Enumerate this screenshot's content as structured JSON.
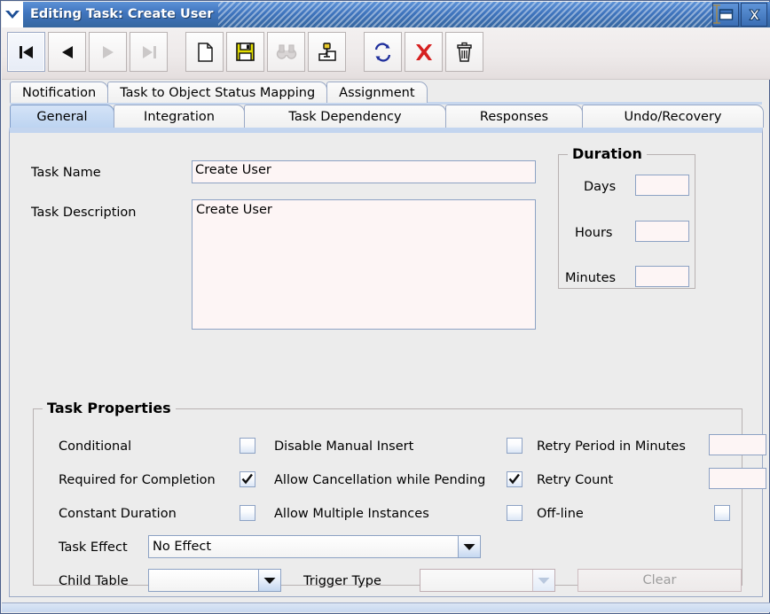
{
  "window": {
    "title": "Editing Task: Create User",
    "menu_icon": "chevron-down-icon",
    "maximize_icon": "maximize-icon",
    "close_icon": "close-icon"
  },
  "toolbar": {
    "buttons": [
      {
        "name": "first-record-button",
        "icon": "first-record-icon",
        "enabled": true,
        "selected": true
      },
      {
        "name": "previous-record-button",
        "icon": "previous-record-icon",
        "enabled": true,
        "selected": false
      },
      {
        "name": "next-record-button",
        "icon": "next-record-icon",
        "enabled": false,
        "selected": false
      },
      {
        "name": "last-record-button",
        "icon": "last-record-icon",
        "enabled": false,
        "selected": false
      },
      {
        "name": "new-button",
        "icon": "new-document-icon",
        "enabled": true,
        "selected": false
      },
      {
        "name": "save-button",
        "icon": "floppy-disk-save-icon",
        "enabled": true,
        "selected": false
      },
      {
        "name": "find-button",
        "icon": "binoculars-find-icon",
        "enabled": false,
        "selected": false
      },
      {
        "name": "query-button",
        "icon": "pushpin-folder-icon",
        "enabled": true,
        "selected": false
      },
      {
        "name": "refresh-button",
        "icon": "refresh-arrows-icon",
        "enabled": true,
        "selected": false
      },
      {
        "name": "delete-button",
        "icon": "red-x-delete-icon",
        "enabled": true,
        "selected": false
      },
      {
        "name": "trash-button",
        "icon": "trash-bin-icon",
        "enabled": true,
        "selected": false
      }
    ]
  },
  "tabs": {
    "row1": [
      {
        "label": "Notification",
        "active": false
      },
      {
        "label": "Task to Object Status Mapping",
        "active": false
      },
      {
        "label": "Assignment",
        "active": false
      }
    ],
    "row2": [
      {
        "label": "General",
        "active": true
      },
      {
        "label": "Integration",
        "active": false
      },
      {
        "label": "Task Dependency",
        "active": false
      },
      {
        "label": "Responses",
        "active": false
      },
      {
        "label": "Undo/Recovery",
        "active": false
      }
    ]
  },
  "general": {
    "task_name_label": "Task Name",
    "task_name_value": "Create User",
    "task_description_label": "Task Description",
    "task_description_value": "Create User"
  },
  "duration": {
    "title": "Duration",
    "days_label": "Days",
    "days_value": "",
    "hours_label": "Hours",
    "hours_value": "",
    "minutes_label": "Minutes",
    "minutes_value": ""
  },
  "task_properties": {
    "title": "Task Properties",
    "checkboxes": [
      {
        "name": "conditional",
        "label": "Conditional",
        "checked": false
      },
      {
        "name": "disable-manual-insert",
        "label": "Disable Manual Insert",
        "checked": false
      },
      {
        "name": "required-for-completion",
        "label": "Required for Completion",
        "checked": true
      },
      {
        "name": "allow-cancellation-while-pending",
        "label": "Allow Cancellation while Pending",
        "checked": true
      },
      {
        "name": "constant-duration",
        "label": "Constant Duration",
        "checked": false
      },
      {
        "name": "allow-multiple-instances",
        "label": "Allow Multiple Instances",
        "checked": false
      },
      {
        "name": "off-line",
        "label": "Off-line",
        "checked": false
      }
    ],
    "retry_period_label": "Retry Period in Minutes",
    "retry_period_value": "",
    "retry_count_label": "Retry Count",
    "retry_count_value": "",
    "task_effect_label": "Task Effect",
    "task_effect_value": "No Effect",
    "child_table_label": "Child Table",
    "child_table_value": "",
    "trigger_type_label": "Trigger Type",
    "trigger_type_value": "",
    "clear_button_label": "Clear"
  },
  "colors": {
    "titlebar": "#3f74bd",
    "active_tab": "#bdd4f1",
    "field_bg": "#fdf5f5",
    "field_border": "#8da2c4",
    "panel_bg": "#ececec",
    "delete_red": "#d92020",
    "save_yellow": "#d8d400",
    "refresh_blue": "#20309c"
  }
}
